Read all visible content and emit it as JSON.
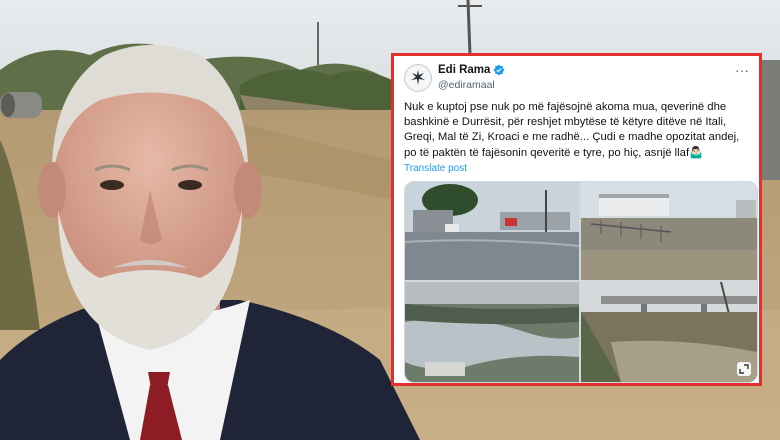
{
  "tweet": {
    "author_name": "Edi Rama",
    "handle": "@ediramaal",
    "more_label": "···",
    "text": "Nuk e kuptoj pse nuk po më fajësojnë akoma mua, qeverinë dhe bashkinë e Durrësit, për reshjet mbytëse të këtyre ditëve në Itali, Greqi, Mal të Zi, Kroaci e me radhë... Çudi e madhe opozitat andej, po të paktën të fajësonin qeveritë e tyre, po hiç, asnjë llaf🤷🏻‍♂️",
    "translate_label": "Translate post"
  },
  "icons": {
    "verified": "verified-badge-icon",
    "more": "more-options-icon",
    "expand": "expand-icon",
    "avatar": "avatar"
  },
  "colors": {
    "frame_border": "#e0312f",
    "link_blue": "#1d9bf0",
    "verified_blue": "#1d9bf0"
  }
}
